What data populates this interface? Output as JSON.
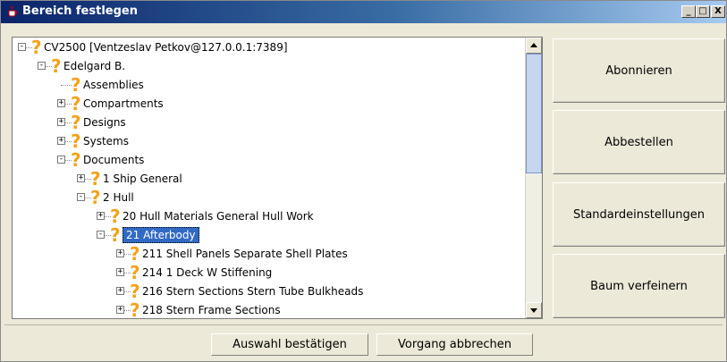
{
  "window": {
    "title": "Bereich festlegen",
    "minimize_label": "_",
    "maximize_label": "□",
    "close_label": "X"
  },
  "tree": {
    "nodes": [
      {
        "label": "CV2500  [Ventzeslav Petkov@127.0.0.1:7389]",
        "level": 0,
        "toggle": "-",
        "icon": "question-icon"
      },
      {
        "label": "Edelgard B.",
        "level": 1,
        "toggle": "-",
        "icon": "question-icon"
      },
      {
        "label": "Assemblies",
        "level": 2,
        "toggle": "",
        "icon": "question-icon"
      },
      {
        "label": "Compartments",
        "level": 2,
        "toggle": "+",
        "icon": "question-icon"
      },
      {
        "label": "Designs",
        "level": 2,
        "toggle": "+",
        "icon": "question-icon"
      },
      {
        "label": "Systems",
        "level": 2,
        "toggle": "+",
        "icon": "question-icon"
      },
      {
        "label": "Documents",
        "level": 2,
        "toggle": "-",
        "icon": "question-icon"
      },
      {
        "label": "1 Ship General",
        "level": 3,
        "toggle": "+",
        "icon": "question-icon"
      },
      {
        "label": "2 Hull",
        "level": 3,
        "toggle": "-",
        "icon": "question-icon"
      },
      {
        "label": "20 Hull Materials General Hull Work",
        "level": 4,
        "toggle": "+",
        "icon": "question-icon"
      },
      {
        "label": "21 Afterbody",
        "level": 4,
        "toggle": "-",
        "icon": "question-icon",
        "selected": true
      },
      {
        "label": "211 Shell Panels Separate Shell Plates",
        "level": 5,
        "toggle": "+",
        "icon": "question-icon"
      },
      {
        "label": "214 1 Deck W Stiffening",
        "level": 5,
        "toggle": "+",
        "icon": "question-icon"
      },
      {
        "label": "216 Stern Sections Stern Tube Bulkheads",
        "level": 5,
        "toggle": "+",
        "icon": "question-icon"
      },
      {
        "label": "218 Stern Frame Sections",
        "level": 5,
        "toggle": "+",
        "icon": "question-icon"
      }
    ]
  },
  "side_buttons": {
    "subscribe": "Abonnieren",
    "unsubscribe": "Abbestellen",
    "defaults": "Standardeinstellungen",
    "refine": "Baum verfeinern"
  },
  "bottom_buttons": {
    "confirm": "Auswahl bestätigen",
    "cancel": "Vorgang abbrechen"
  }
}
